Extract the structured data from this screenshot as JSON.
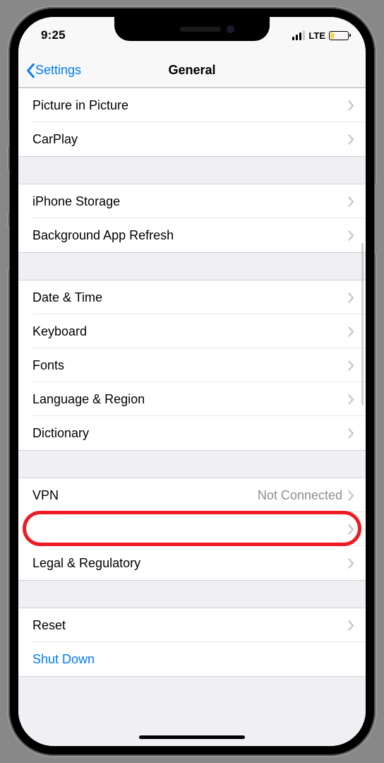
{
  "status": {
    "time": "9:25",
    "network_type": "LTE"
  },
  "nav": {
    "back_label": "Settings",
    "title": "General"
  },
  "groups": [
    {
      "rows": [
        {
          "label": "Picture in Picture"
        },
        {
          "label": "CarPlay"
        }
      ]
    },
    {
      "rows": [
        {
          "label": "iPhone Storage"
        },
        {
          "label": "Background App Refresh"
        }
      ]
    },
    {
      "rows": [
        {
          "label": "Date & Time"
        },
        {
          "label": "Keyboard"
        },
        {
          "label": "Fonts"
        },
        {
          "label": "Language & Region"
        },
        {
          "label": "Dictionary"
        }
      ]
    },
    {
      "rows": [
        {
          "label": "VPN",
          "detail": "Not Connected"
        },
        {
          "label": ""
        },
        {
          "label": "Legal & Regulatory"
        }
      ]
    },
    {
      "rows": [
        {
          "label": "Reset"
        },
        {
          "label": "Shut Down",
          "blue": true,
          "no_chev": true
        }
      ]
    }
  ],
  "highlight": {
    "group_index": 3,
    "row_index": 1
  }
}
